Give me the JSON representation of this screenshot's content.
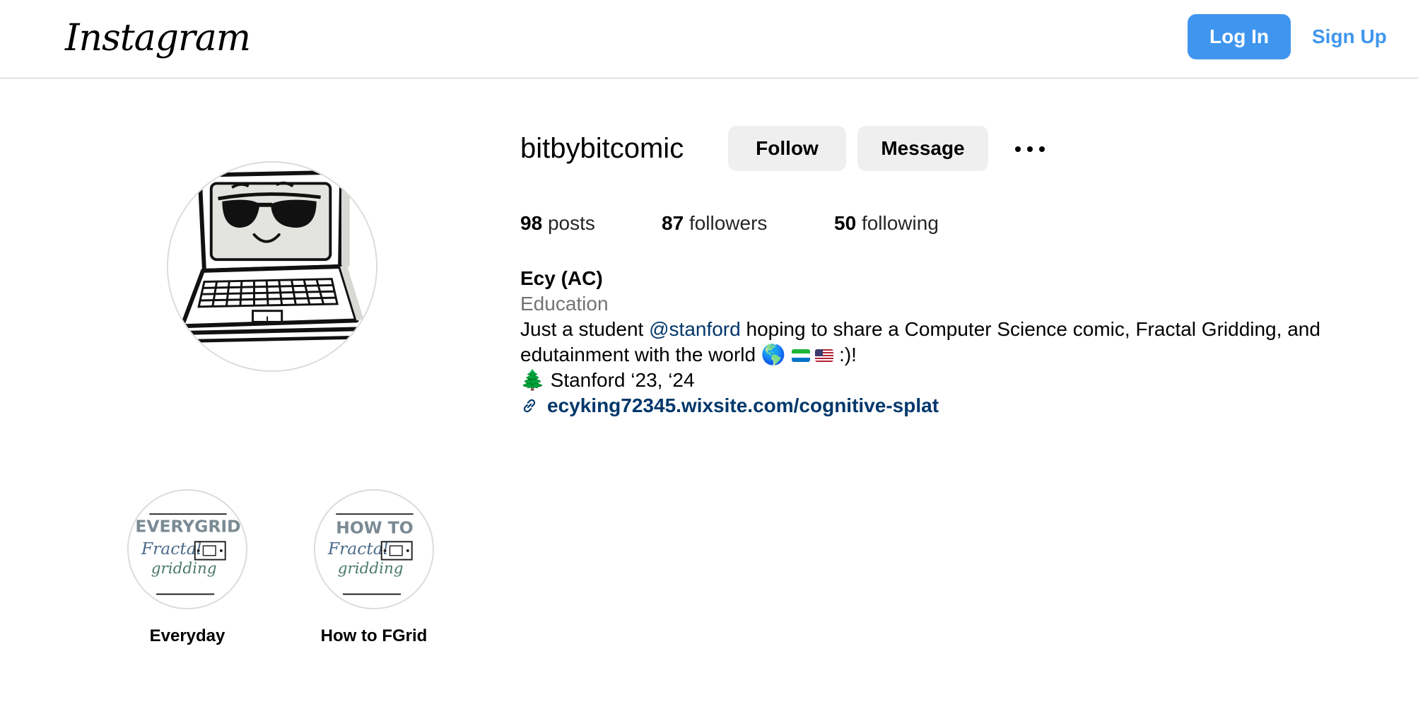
{
  "nav": {
    "logo": "Instagram",
    "login_label": "Log In",
    "signup_label": "Sign Up"
  },
  "profile": {
    "username": "bitbybitcomic",
    "follow_label": "Follow",
    "message_label": "Message",
    "more_icon": "more-horizontal-icon",
    "stats": {
      "posts_count": "98",
      "posts_label": "posts",
      "followers_count": "87",
      "followers_label": "followers",
      "following_count": "50",
      "following_label": "following"
    },
    "bio": {
      "name": "Ecy (AC)",
      "category": "Education",
      "line1_before": "Just a student ",
      "mention": "@stanford",
      "line1_after": " hoping to share a Computer Science comic, Fractal Gridding, and",
      "line2_text": "edutainment with the world ",
      "line2_emoji": "🌎",
      "line2_end": " :)!",
      "line3_emoji": "🌲",
      "line3_text": " Stanford ‘23, ‘24",
      "link": "ecyking72345.wixsite.com/cognitive-splat"
    }
  },
  "highlights": [
    {
      "label": "Everyday",
      "cover_title": "EVERYGRID",
      "cover_script_1": "Fractal",
      "cover_script_2": "gridding"
    },
    {
      "label": "How to FGrid",
      "cover_title": "HOW TO",
      "cover_script_1": "Fractal",
      "cover_script_2": "gridding"
    }
  ],
  "colors": {
    "accent_blue": "#4096ee",
    "link_blue": "#00376b",
    "button_gray": "#efefef",
    "secondary_text": "#737373",
    "divider": "#c7c7c7"
  }
}
